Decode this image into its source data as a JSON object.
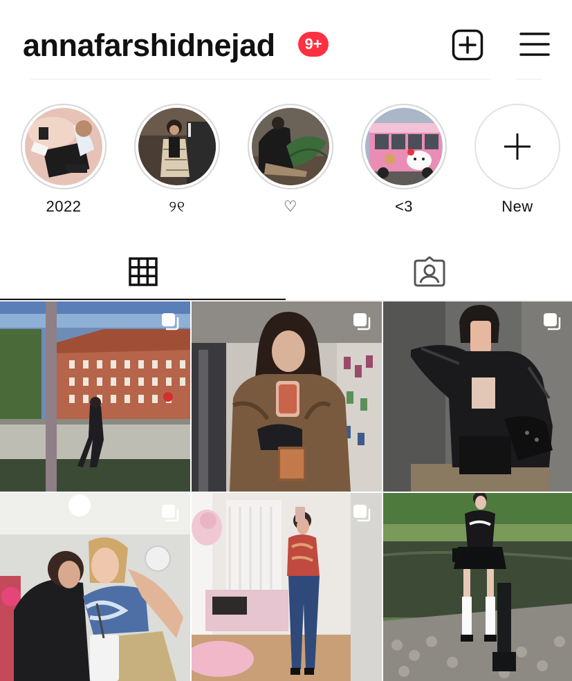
{
  "profile": {
    "username": "annafarshidnejad",
    "notification_badge": "9+",
    "badge_color": "#ff3040"
  },
  "header_actions": {
    "create_icon": "plus-square-icon",
    "menu_icon": "hamburger-menu-icon"
  },
  "highlights": [
    {
      "label": "2022",
      "icon": "highlight-photo"
    },
    {
      "label": "୨୧",
      "icon": "highlight-photo"
    },
    {
      "label": "♡",
      "icon": "highlight-photo"
    },
    {
      "label": "<3",
      "icon": "highlight-photo"
    },
    {
      "label": "New",
      "icon": "plus-icon"
    }
  ],
  "tabs": [
    {
      "name": "posts",
      "icon": "grid-icon",
      "active": true
    },
    {
      "name": "tagged",
      "icon": "tagged-person-icon",
      "active": false
    }
  ],
  "posts": [
    {
      "icon": "multi-photo-icon"
    },
    {
      "icon": "multi-photo-icon"
    },
    {
      "icon": "multi-photo-icon"
    },
    {
      "icon": "multi-photo-icon"
    },
    {
      "icon": "multi-photo-icon"
    },
    {
      "icon": "none"
    }
  ]
}
